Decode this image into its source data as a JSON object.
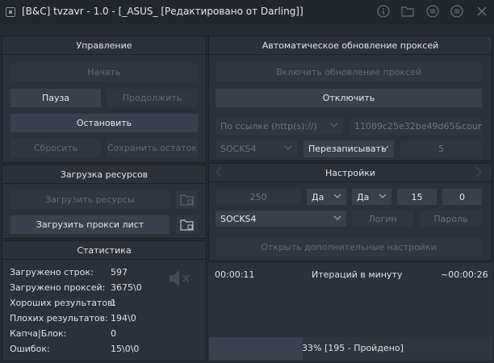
{
  "window": {
    "title": "[B&C] tvzavr - 1.0 - [_ASUS_ [Редактировано от Darling]]"
  },
  "control": {
    "header": "Управление",
    "start": "Начать",
    "pause": "Пауза",
    "resume": "Продолжить",
    "stop": "Остановить",
    "reset": "Сбросить",
    "save_rest": "Сохранить остаток"
  },
  "resources": {
    "header": "Загрузка ресурсов",
    "load_resources": "Загрузить ресурсы",
    "load_proxy": "Загрузить прокси лист"
  },
  "stats": {
    "header": "Статистика",
    "rows": [
      {
        "label": "Загружено строк:",
        "value": "597"
      },
      {
        "label": "Загружено проксей:",
        "value": "3675\\0"
      },
      {
        "label": "Хороших результатов:",
        "value": "1"
      },
      {
        "label": "Плохих результатов:",
        "value": "194\\0"
      },
      {
        "label": "Капча|Блок:",
        "value": "0"
      },
      {
        "label": "Ошибок:",
        "value": "15\\0\\0"
      }
    ]
  },
  "proxy_update": {
    "header": "Автоматическое обновление проксей",
    "enable": "Включить обновление проксей",
    "disable": "Отключить",
    "source": "По ссылке (http(s)://)",
    "url": "11089c25e32be49d65&countrie",
    "type": "SOCKS4",
    "mode": "Перезаписывать",
    "interval": "5"
  },
  "settings": {
    "header": "Настройки",
    "threads": "250",
    "opt1": "Да",
    "opt2": "Да",
    "timeout": "15",
    "retries": "0",
    "proxy_type": "SOCKS4",
    "login": "Логин",
    "password": "Пароль",
    "advanced": "Открыть дополнительные настройки"
  },
  "status": {
    "elapsed": "00:00:11",
    "rate_label": "Итераций в минуту",
    "remaining": "~00:00:26",
    "progress_text": "33% [195 - Пройдено]",
    "progress_fraction": 0.33
  }
}
